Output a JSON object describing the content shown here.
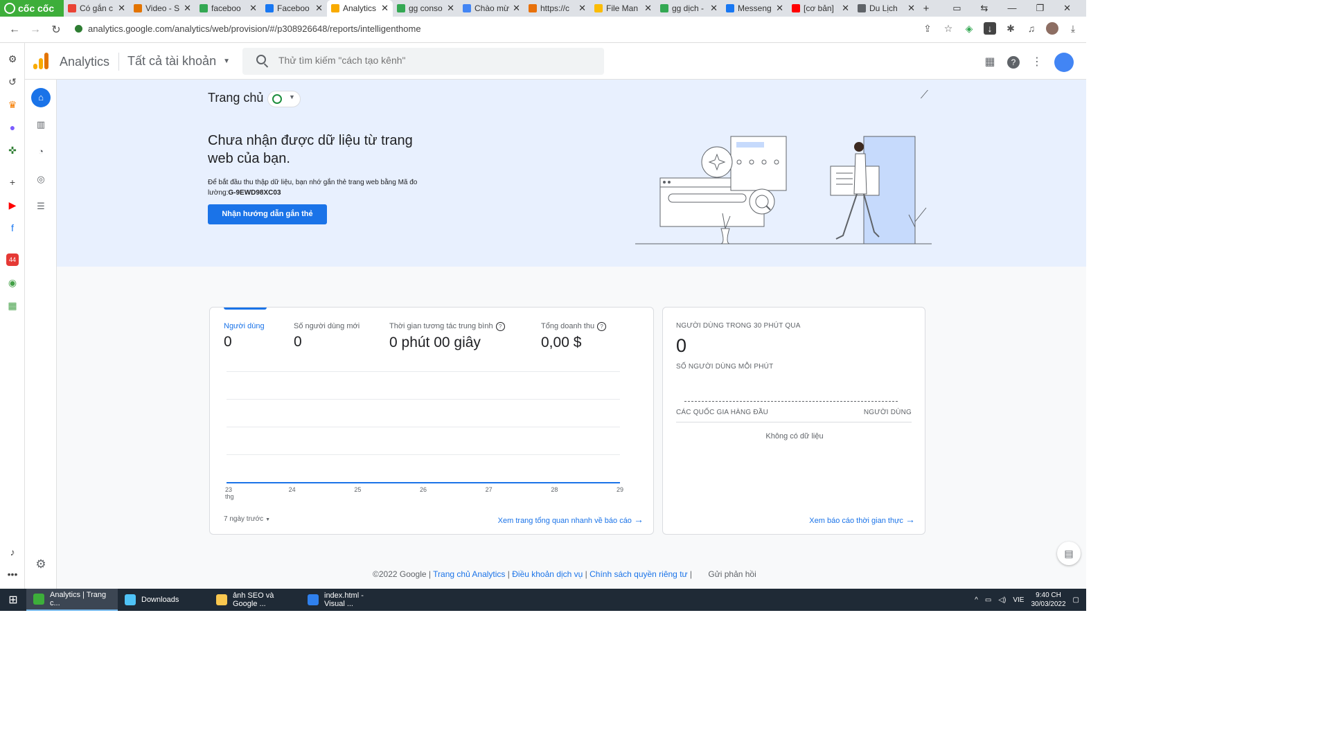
{
  "browser": {
    "brand": "cốc cốc",
    "tabs": [
      {
        "label": "Có gắn c",
        "color": "#ea4335"
      },
      {
        "label": "Video - S",
        "color": "#e37400"
      },
      {
        "label": "faceboo",
        "color": "#34a853"
      },
      {
        "label": "Faceboo",
        "color": "#1877f2"
      },
      {
        "label": "Analytics",
        "color": "#f9ab00",
        "active": true
      },
      {
        "label": "gg conso",
        "color": "#34a853"
      },
      {
        "label": "Chào mừ",
        "color": "#4285f4"
      },
      {
        "label": "https://c",
        "color": "#e8710a"
      },
      {
        "label": "File Man",
        "color": "#fbbc04"
      },
      {
        "label": "gg dịch -",
        "color": "#34a853"
      },
      {
        "label": "Messeng",
        "color": "#1877f2"
      },
      {
        "label": "[cơ bản]",
        "color": "#ff0000"
      },
      {
        "label": "Du Lịch",
        "color": "#5f6368"
      }
    ],
    "url": "analytics.google.com/analytics/web/provision/#/p308926648/reports/intelligenthome"
  },
  "ga": {
    "product": "Analytics",
    "account": "Tất cả tài khoản",
    "search_placeholder": "Thử tìm kiếm \"cách tạo kênh\""
  },
  "banner": {
    "page_title": "Trang chủ",
    "headline": "Chưa nhận được dữ liệu từ trang web của bạn.",
    "desc_prefix": "Để bắt đầu thu thập dữ liệu, bạn nhớ gắn thẻ trang web bằng Mã đo lường:",
    "measurement_id": "G-9EWD98XC03",
    "cta": "Nhận hướng dẫn gắn thẻ"
  },
  "overview": {
    "metrics": [
      {
        "label": "Người dùng",
        "value": "0"
      },
      {
        "label": "Số người dùng mới",
        "value": "0"
      },
      {
        "label": "Thời gian tương tác trung bình",
        "value": "0 phút 00 giây"
      },
      {
        "label": "Tổng doanh thu",
        "value": "0,00 $"
      }
    ],
    "ticks": [
      "23",
      "24",
      "25",
      "26",
      "27",
      "28",
      "29"
    ],
    "tick_sub": "thg",
    "period": "7 ngày trước",
    "link": "Xem trang tổng quan nhanh về báo cáo"
  },
  "realtime": {
    "title": "NGƯỜI DÙNG TRONG 30 PHÚT QUA",
    "value": "0",
    "per_minute": "SỐ NGƯỜI DÙNG MỖI PHÚT",
    "countries": "CÁC QUỐC GIA HÀNG ĐẦU",
    "users": "NGƯỜI DÙNG",
    "nodata": "Không có dữ liệu",
    "link": "Xem báo cáo thời gian thực"
  },
  "footer": {
    "copyright": "©2022 Google",
    "home": "Trang chủ Analytics",
    "terms": "Điều khoản dịch vụ",
    "privacy": "Chính sách quyền riêng tư",
    "feedback": "Gửi phản hồi"
  },
  "taskbar": {
    "items": [
      {
        "label": "Analytics | Trang c...",
        "color": "#3dae3a"
      },
      {
        "label": "Downloads",
        "color": "#4fc3f7"
      },
      {
        "label": "ảnh SEO và Google ...",
        "color": "#f9c74f"
      },
      {
        "label": "index.html - Visual ...",
        "color": "#2f80ed"
      }
    ],
    "lang": "VIE",
    "time": "9:40 CH",
    "date": "30/03/2022"
  },
  "icons": {
    "home": "home-icon",
    "reports": "bar-chart-icon",
    "explore": "explore-icon",
    "advertising": "target-icon",
    "configure": "list-icon",
    "settings": "gear-icon"
  },
  "colors": {
    "accent": "#1a73e8",
    "banner_bg": "#e8f0fe",
    "coccoc_green": "#3dae3a"
  }
}
